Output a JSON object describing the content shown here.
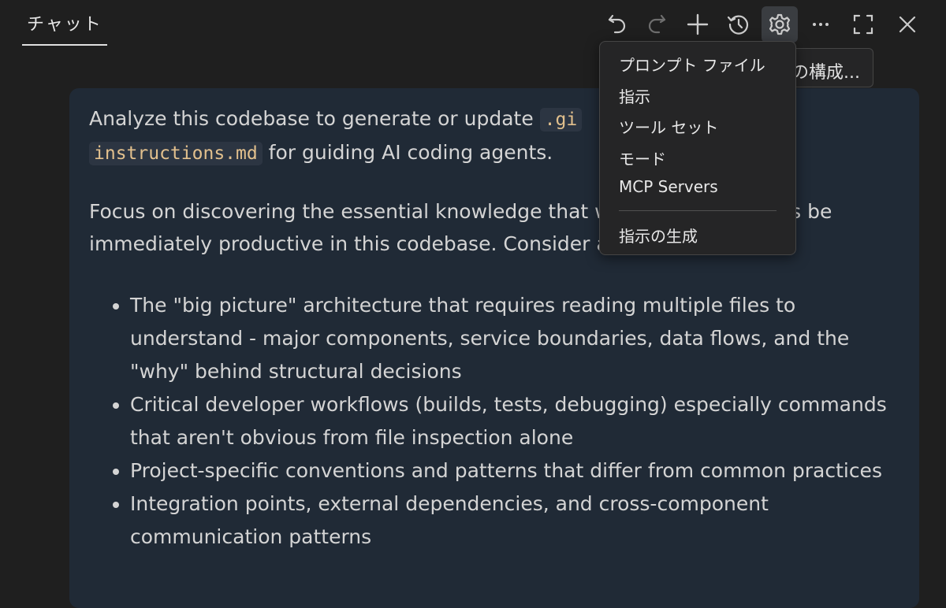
{
  "header": {
    "tab_label": "チャット"
  },
  "toolbar": {
    "icons": [
      "undo-icon",
      "redo-icon",
      "plus-icon",
      "history-icon",
      "gear-icon",
      "more-icon",
      "maximize-icon",
      "close-icon"
    ]
  },
  "tooltip": {
    "text": "の構成..."
  },
  "menu": {
    "items": [
      "プロンプト ファイル",
      "指示",
      "ツール セット",
      "モード",
      "MCP Servers"
    ],
    "generate_label": "指示の生成"
  },
  "message": {
    "p1_before": "Analyze this codebase to generate or update ",
    "p1_code1": ".gi",
    "p1_code2": "instructions.md",
    "p1_after": " for guiding AI coding agents.",
    "p2": "Focus on discovering the essential knowledge that would help AI agents be immediately productive in this codebase. Consider aspects like:",
    "bullets": [
      "The \"big picture\" architecture that requires reading multiple files to understand - major components, service boundaries, data flows, and the \"why\" behind structural decisions",
      "Critical developer workflows (builds, tests, debugging) especially commands that aren't obvious from file inspection alone",
      "Project-specific conventions and patterns that differ from common practices",
      "Integration points, external dependencies, and cross-component communication patterns"
    ]
  },
  "colors": {
    "background": "#1f1f1f",
    "message_bg": "#202a36",
    "code_text": "#e2c08d",
    "menu_bg": "#252526"
  }
}
